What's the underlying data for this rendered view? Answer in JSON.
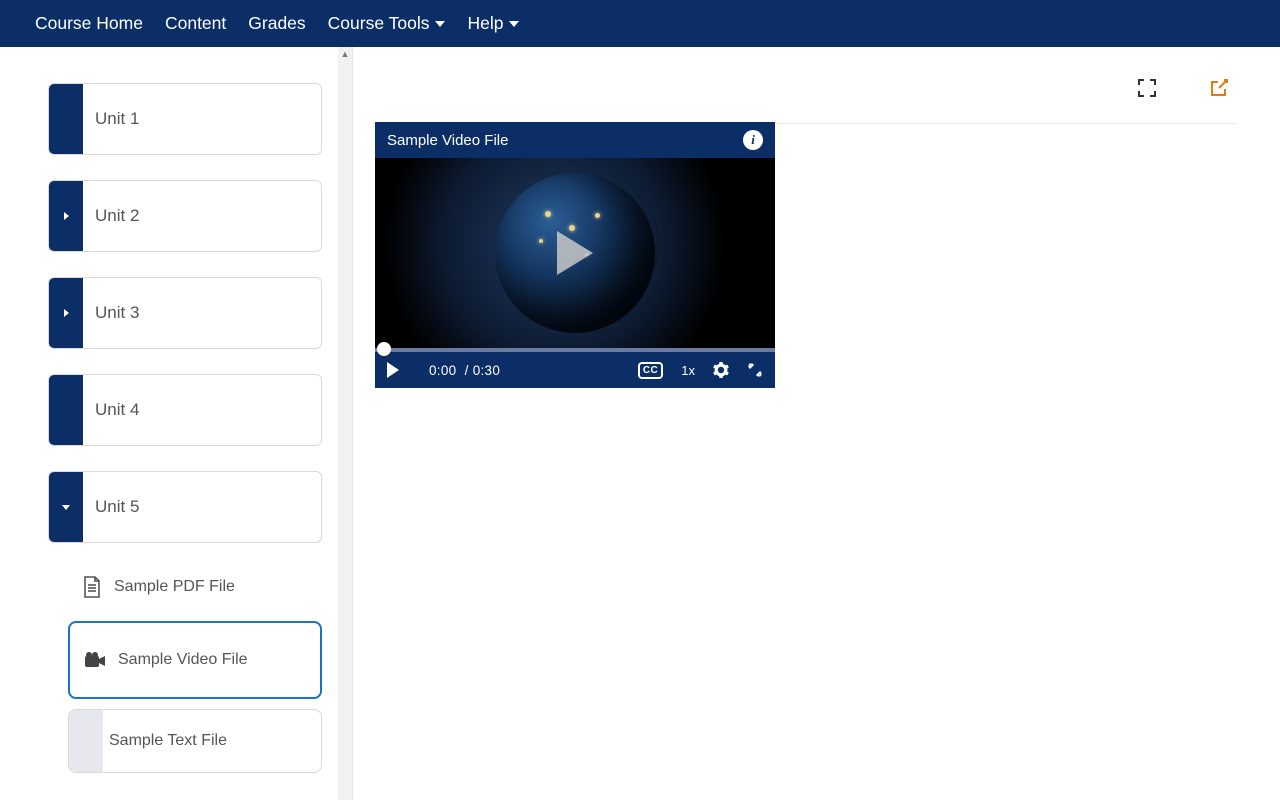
{
  "nav": {
    "items": [
      {
        "label": "Course Home"
      },
      {
        "label": "Content"
      },
      {
        "label": "Grades"
      },
      {
        "label": "Course Tools",
        "dropdown": true
      },
      {
        "label": "Help",
        "dropdown": true
      }
    ]
  },
  "sidebar": {
    "units": [
      {
        "label": "Unit 1",
        "arrow": "none"
      },
      {
        "label": "Unit 2",
        "arrow": "right"
      },
      {
        "label": "Unit 3",
        "arrow": "right"
      },
      {
        "label": "Unit 4",
        "arrow": "none"
      },
      {
        "label": "Unit 5",
        "arrow": "down"
      }
    ],
    "sub_pdf": "Sample PDF File",
    "sub_video": "Sample Video File",
    "sub_text": "Sample Text File"
  },
  "video": {
    "title": "Sample Video File",
    "current_time": "0:00",
    "duration": "0:30",
    "speed": "1x",
    "cc": "CC"
  },
  "colors": {
    "brand": "#0b2e66",
    "accent_orange": "#e67817",
    "selected_blue": "#1a73c9"
  }
}
